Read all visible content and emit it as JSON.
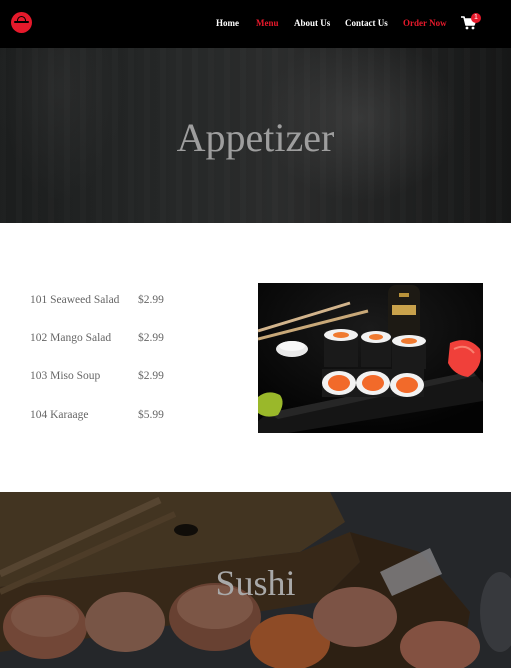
{
  "nav": {
    "links": [
      {
        "label": "Home"
      },
      {
        "label": "Menu"
      },
      {
        "label": "About Us"
      },
      {
        "label": "Contact Us"
      },
      {
        "label": "Order Now"
      }
    ],
    "cart_count": "1",
    "colors": {
      "accent": "#e6192b",
      "background": "#000000"
    }
  },
  "hero": {
    "title": "Appetizer"
  },
  "appetizers": {
    "items": [
      {
        "name": "101 Seaweed Salad",
        "price": "$2.99"
      },
      {
        "name": "102 Mango Salad",
        "price": "$2.99"
      },
      {
        "name": "103 Miso Soup",
        "price": "$2.99"
      },
      {
        "name": "104 Karaage",
        "price": "$5.99"
      }
    ]
  },
  "sushi": {
    "title": "Sushi"
  }
}
